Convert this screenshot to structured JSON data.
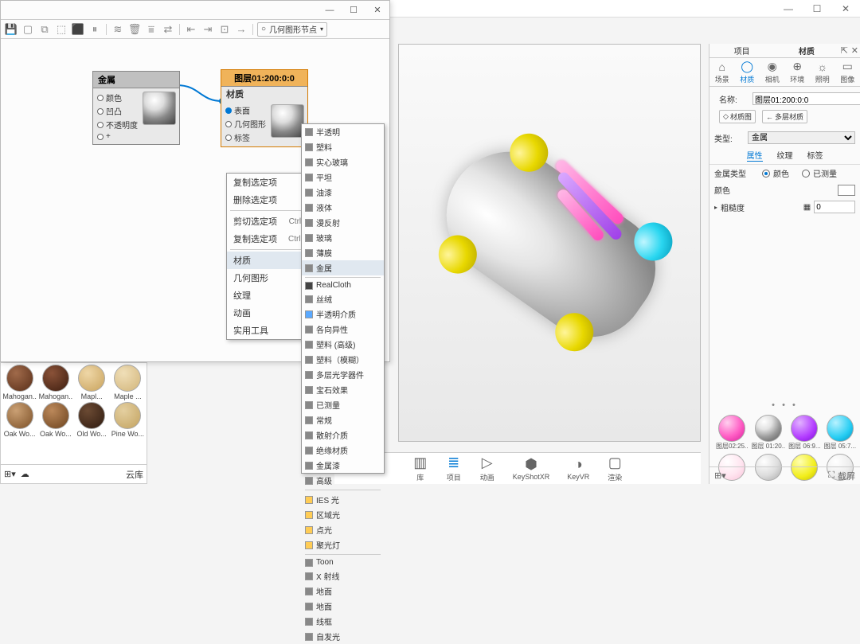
{
  "mainTitlebar": {
    "min": "—",
    "max": "☐",
    "close": "✕"
  },
  "nodeEditor": {
    "title_min": "—",
    "title_max": "☐",
    "title_close": "✕",
    "toolbarDropdown": "几何图形节点",
    "nodes": {
      "metal": {
        "title": "金属",
        "ports": [
          "颜色",
          "凹凸",
          "不透明度",
          "+"
        ]
      },
      "material": {
        "header": "图层01:200:0:0",
        "title": "材质",
        "ports": [
          "表面",
          "几何图形",
          "标签"
        ]
      }
    }
  },
  "contextMenu": {
    "items": [
      {
        "label": "复制选定项"
      },
      {
        "label": "删除选定项"
      },
      {
        "sep": true
      },
      {
        "label": "剪切选定项",
        "hot": "Ctrl+X"
      },
      {
        "label": "复制选定项",
        "hot": "Ctrl+C"
      },
      {
        "sep": true
      },
      {
        "label": "材质",
        "arrow": true,
        "hl": true
      },
      {
        "label": "几何图形",
        "arrow": true
      },
      {
        "label": "纹理",
        "arrow": true
      },
      {
        "label": "动画",
        "arrow": true
      },
      {
        "label": "实用工具",
        "arrow": true
      }
    ]
  },
  "materialSubmenu": [
    {
      "label": "半透明",
      "c": "#888"
    },
    {
      "label": "塑料",
      "c": "#888"
    },
    {
      "label": "实心玻璃",
      "c": "#888"
    },
    {
      "label": "平坦",
      "c": "#888"
    },
    {
      "label": "油漆",
      "c": "#888"
    },
    {
      "label": "液体",
      "c": "#888"
    },
    {
      "label": "漫反射",
      "c": "#888"
    },
    {
      "label": "玻璃",
      "c": "#888"
    },
    {
      "label": "薄膜",
      "c": "#888"
    },
    {
      "label": "金属",
      "c": "#888",
      "hl": true
    },
    {
      "sep": true
    },
    {
      "label": "RealCloth",
      "c": "#444"
    },
    {
      "label": "丝绒",
      "c": "#888"
    },
    {
      "label": "半透明介质",
      "c": "#5aa9ff"
    },
    {
      "label": "各向异性",
      "c": "#888"
    },
    {
      "label": "塑料 (高级)",
      "c": "#888"
    },
    {
      "label": "塑料（模糊）",
      "c": "#888"
    },
    {
      "label": "多层光学器件",
      "c": "#888"
    },
    {
      "label": "宝石效果",
      "c": "#888"
    },
    {
      "label": "已测量",
      "c": "#888"
    },
    {
      "label": "常规",
      "c": "#888"
    },
    {
      "label": "散射介质",
      "c": "#888"
    },
    {
      "label": "绝缘材质",
      "c": "#888"
    },
    {
      "label": "金属漆",
      "c": "#888"
    },
    {
      "label": "高级",
      "c": "#888"
    },
    {
      "sep": true
    },
    {
      "label": "IES 光",
      "c": "#fc5"
    },
    {
      "label": "区域光",
      "c": "#fc5"
    },
    {
      "label": "点光",
      "c": "#fc5"
    },
    {
      "label": "聚光灯",
      "c": "#fc5"
    },
    {
      "sep": true
    },
    {
      "label": "Toon",
      "c": "#888"
    },
    {
      "label": "X 射线",
      "c": "#888"
    },
    {
      "label": "地面",
      "c": "#888"
    },
    {
      "label": "地面",
      "c": "#888"
    },
    {
      "label": "线框",
      "c": "#888"
    },
    {
      "label": "自发光",
      "c": "#888"
    }
  ],
  "matLibrary": {
    "row1": [
      {
        "label": "Mahogan..",
        "bg": "radial-gradient(circle at 35% 30%,#a06a4a,#5a2f19)"
      },
      {
        "label": "Mahogan..",
        "bg": "radial-gradient(circle at 35% 30%,#8a5238,#3e1e10)"
      },
      {
        "label": "Mapl...",
        "bg": "radial-gradient(circle at 35% 30%,#efd7a7,#c9a35d)"
      },
      {
        "label": "Maple ...",
        "bg": "radial-gradient(circle at 35% 30%,#f0dfb8,#d2b57a)"
      }
    ],
    "row2": [
      {
        "label": "Oak Wo...",
        "bg": "radial-gradient(circle at 35% 30%,#caa074,#7d5128)"
      },
      {
        "label": "Oak Wo...",
        "bg": "radial-gradient(circle at 35% 30%,#bb885a,#6d441f)"
      },
      {
        "label": "Old Wo...",
        "bg": "radial-gradient(circle at 35% 30%,#6b4a33,#2f1b10)"
      },
      {
        "label": "Pine Wo...",
        "bg": "radial-gradient(circle at 35% 30%,#e4cfa0,#c3a360)"
      }
    ],
    "cloud": "云库"
  },
  "bottomBar": {
    "items": [
      {
        "label": "库",
        "glyph": "▥"
      },
      {
        "label": "项目",
        "glyph": "≣",
        "active": true
      },
      {
        "label": "动画",
        "glyph": "▷"
      },
      {
        "label": "KeyShotXR",
        "glyph": "⬢"
      },
      {
        "label": "KeyVR",
        "glyph": "◑"
      },
      {
        "label": "渲染",
        "glyph": "▢"
      }
    ]
  },
  "rightPanel": {
    "tabs": {
      "left": "项目",
      "center": "材质"
    },
    "toprow": [
      {
        "label": "场景",
        "g": "⌂"
      },
      {
        "label": "材质",
        "g": "◯",
        "active": true
      },
      {
        "label": "相机",
        "g": "◉"
      },
      {
        "label": "环境",
        "g": "⊕"
      },
      {
        "label": "照明",
        "g": "☼"
      },
      {
        "label": "图像",
        "g": "▭"
      }
    ],
    "nameLabel": "名称:",
    "nameValue": "图层01:200:0:0",
    "chipGraph": "材质图",
    "chipMulti": "多层材质",
    "typeLabel": "类型:",
    "typeValue": "金属",
    "subtabs": [
      "属性",
      "纹理",
      "标签"
    ],
    "metalType": "金属类型",
    "radioColor": "颜色",
    "radioMeasured": "已测量",
    "colorLabel": "颜色",
    "roughLabel": "粗糙度",
    "roughVal": "0",
    "swatchHeader": "• • •",
    "swatches": [
      {
        "label": "图层02:25..",
        "bg": "radial-gradient(circle at 33% 28%,#ffd0ef,#ff5ec5 55%,#d81e9a)"
      },
      {
        "label": "图层 01:20..",
        "bg": "radial-gradient(circle at 33% 24%,#fff,#e3e3e3 30%,#9b9b9b 60%,#555)"
      },
      {
        "label": "图层 06:9...",
        "bg": "radial-gradient(circle at 33% 28%,#e2b2ff,#b23bff 60%,#7a0fd6)"
      },
      {
        "label": "图层 05:7...",
        "bg": "radial-gradient(circle at 33% 28%,#b8f2ff,#26cdf3 60%,#008fbf)"
      },
      {
        "label": "",
        "bg": "radial-gradient(circle at 33% 28%,#fff,#ffe5f0 55%,#f9c3d8)"
      },
      {
        "label": "",
        "bg": "radial-gradient(circle at 33% 28%,#fff,#ddd 55%,#aaa)"
      },
      {
        "label": "",
        "bg": "radial-gradient(circle at 33% 28%,#ffffb3,#f2ee1c 60%,#c2bc00)"
      },
      {
        "label": "",
        "bg": "radial-gradient(circle at 33% 28%,#fff,#eee 55%,#ccc)"
      }
    ],
    "footerRight": "截屏"
  }
}
